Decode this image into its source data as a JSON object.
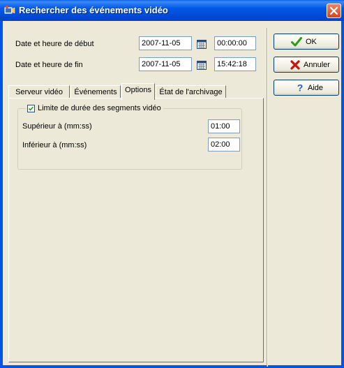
{
  "window": {
    "title": "Rechercher des événements vidéo"
  },
  "start": {
    "label": "Date et heure de début",
    "date": "2007-11-05",
    "time": "00:00:00"
  },
  "end": {
    "label": "Date et heure de fin",
    "date": "2007-11-05",
    "time": "15:42:18"
  },
  "buttons": {
    "ok": "OK",
    "cancel": "Annuler",
    "help": "Aide"
  },
  "tabs": [
    "Serveur vidéo",
    "Événements",
    "Options",
    "État de l'archivage"
  ],
  "active_tab": "Options",
  "options": {
    "group_label": "Limite de durée des segments vidéo",
    "checked": true,
    "upper_label": "Supérieur à (mm:ss)",
    "upper_value": "01:00",
    "lower_label": "Inférieur à (mm:ss)",
    "lower_value": "02:00"
  },
  "colors": {
    "titlebar": "#0054e3",
    "dialog_bg": "#ece9d8",
    "ok_icon": "#2e9a18",
    "cancel_icon": "#c4160a",
    "help_icon": "#1f5fbf"
  }
}
